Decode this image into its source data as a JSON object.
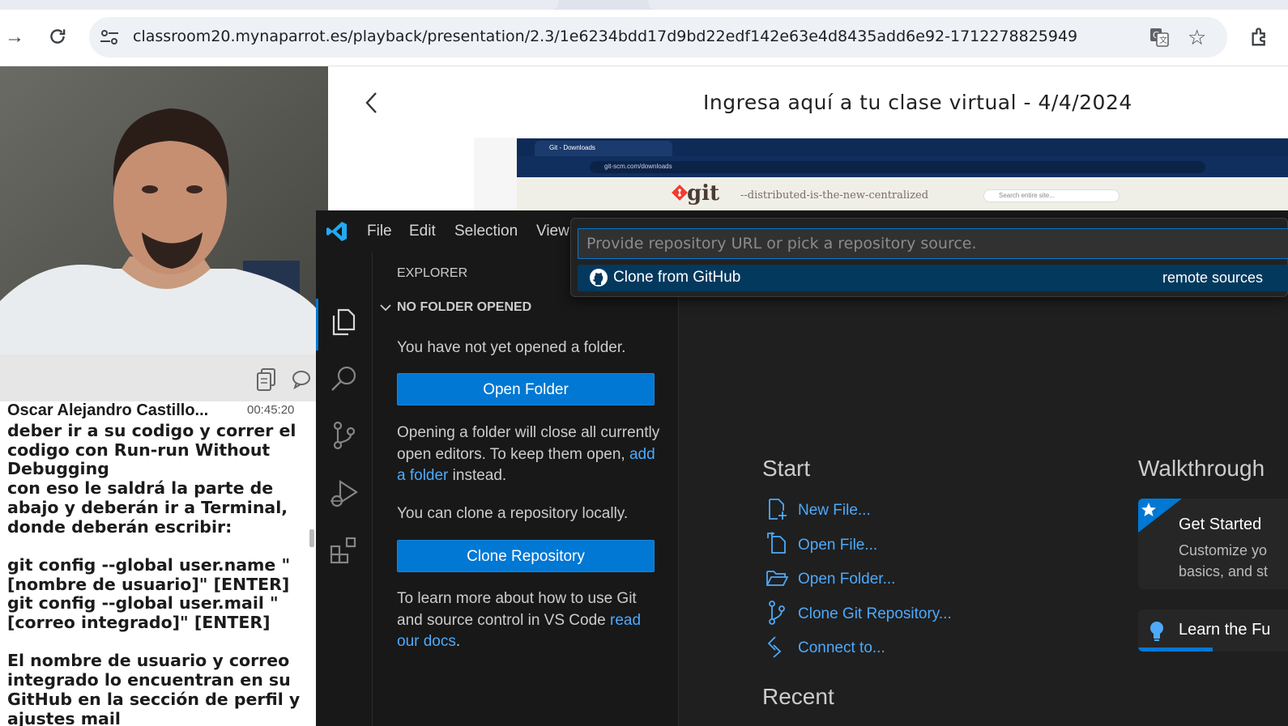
{
  "browser": {
    "url": "classroom20.mynaparrot.es/playback/presentation/2.3/1e6234bdd17d9bd22edf142e63e4d8435add6e92-1712278825949"
  },
  "presentation": {
    "title": "Ingresa aquí a tu clase virtual - 4/4/2024",
    "slide": {
      "tab_title": "Git - Downloads",
      "url": "git-scm.com/downloads",
      "logo_text": "git",
      "tagline": "--distributed-is-the-new-centralized",
      "search_placeholder": "Search entire site..."
    }
  },
  "chat": {
    "author": "Oscar Alejandro Castillo...",
    "time": "00:45:20",
    "message": "deber ir a su codigo y correr el codigo con Run-run Without Debugging\ncon eso le saldrá la parte de abajo y deberán ir a Terminal, donde deberán escribir:\n\ngit config --global user.name \"[nombre de usuario]\" [ENTER]\ngit config --global user.mail \"[correo integrado]\" [ENTER]\n\nEl nombre de usuario y correo integrado lo encuentran en su GitHub en la sección de perfil y ajustes mail"
  },
  "vscode": {
    "menu": [
      "File",
      "Edit",
      "Selection",
      "View"
    ],
    "explorer": {
      "title": "EXPLORER",
      "section": "NO FOLDER OPENED",
      "no_folder_text": "You have not yet opened a folder.",
      "open_folder_button": "Open Folder",
      "opening_text_1": "Opening a folder will close all currently open editors. To keep them open,",
      "add_folder_link": "add a folder",
      "opening_text_2": "instead.",
      "clone_text": "You can clone a repository locally.",
      "clone_button": "Clone Repository",
      "learn_text": "To learn more about how to use Git and source control in VS Code",
      "docs_link": "read our docs",
      "docs_suffix": "."
    },
    "quickpick": {
      "placeholder": "Provide repository URL or pick a repository source.",
      "item_label": "Clone from GitHub",
      "item_desc": "remote sources"
    },
    "welcome": {
      "start_heading": "Start",
      "start_items": [
        "New File...",
        "Open File...",
        "Open Folder...",
        "Clone Git Repository...",
        "Connect to..."
      ],
      "recent_heading": "Recent",
      "walkthrough_heading": "Walkthrough",
      "walkthrough_1_title": "Get Started",
      "walkthrough_1_line1": "Customize yo",
      "walkthrough_1_line2": "basics, and st",
      "walkthrough_2_title": "Learn the Fu"
    }
  }
}
